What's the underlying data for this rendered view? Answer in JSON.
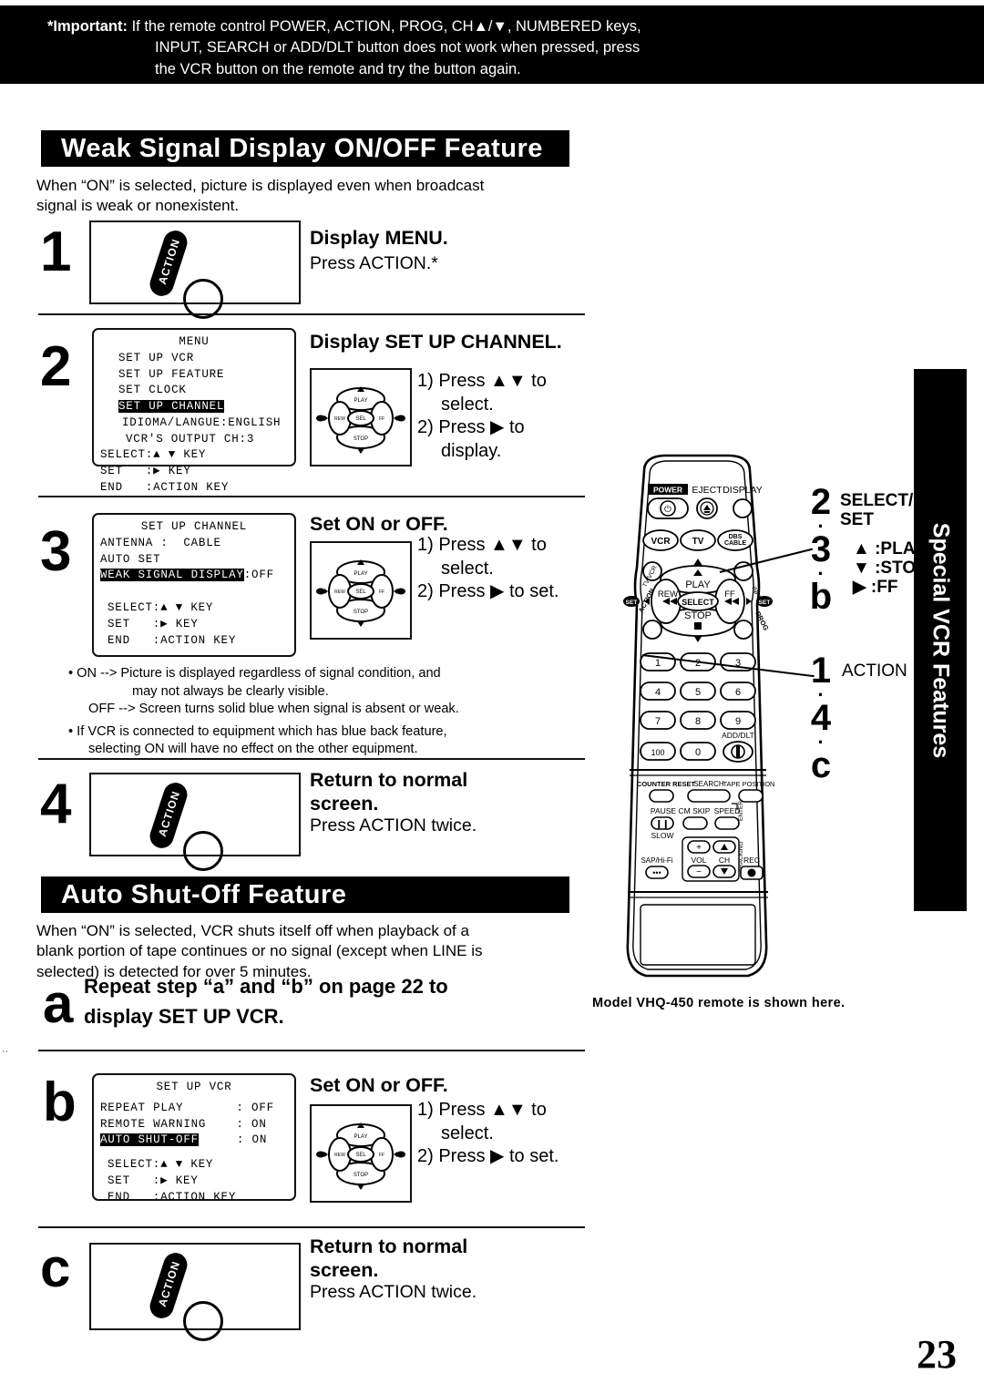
{
  "important": {
    "label": "*Important:",
    "line1": "If the remote control POWER, ACTION, PROG, CH▲/▼, NUMBERED keys,",
    "line2": "INPUT,  SEARCH or ADD/DLT button does not work when pressed, press",
    "line3": "the VCR button on the remote and try the button again."
  },
  "section1": {
    "banner": "Weak Signal Display ON/OFF Feature",
    "intro_line1": "When “ON” is selected, picture is displayed even when broadcast",
    "intro_line2": "signal is weak or nonexistent.",
    "step1": {
      "number": "1",
      "button_label": "ACTION",
      "heading": "Display MENU.",
      "sub": "Press ACTION.*"
    },
    "step2": {
      "number": "2",
      "heading": "Display SET UP CHANNEL.",
      "osd": {
        "title": "MENU",
        "rows": [
          "SET UP VCR",
          "SET UP FEATURE",
          "SET CLOCK"
        ],
        "highlight": "SET UP CHANNEL",
        "rows_after": [
          "IDIOMA/LANGUE:ENGLISH",
          "VCR'S OUTPUT CH:3"
        ],
        "footer": [
          "SELECT:▲ ▼ KEY",
          "SET   :▶ KEY",
          "END   :ACTION KEY"
        ]
      },
      "instr1": "1) Press ▲▼ to",
      "instr1b": "select.",
      "instr2": "2) Press ▶ to",
      "instr2b": "display."
    },
    "step3": {
      "number": "3",
      "heading": "Set ON or OFF.",
      "osd": {
        "title": "SET UP CHANNEL",
        "rows": [
          "ANTENNA :  CABLE",
          "AUTO SET"
        ],
        "highlight": "WEAK SIGNAL DISPLAY",
        "highlight_value": ":OFF",
        "footer": [
          "SELECT:▲ ▼ KEY",
          "SET   :▶ KEY",
          "END   :ACTION KEY"
        ]
      },
      "instr1": "1) Press ▲▼ to",
      "instr1b": "select.",
      "instr2": "2) Press ▶ to set."
    },
    "notes": {
      "n1a": "ON  --> Picture is displayed regardless of signal condition, and",
      "n1b": "may not always be clearly visible.",
      "n1c": "OFF --> Screen turns solid blue when signal is absent or weak.",
      "n2a": "If VCR is connected to equipment which has blue back feature,",
      "n2b": "selecting ON will have no effect on the other equipment."
    },
    "step4": {
      "number": "4",
      "button_label": "ACTION",
      "heading_line1": "Return to normal",
      "heading_line2": "screen.",
      "sub": "Press ACTION twice."
    }
  },
  "section2": {
    "banner": "Auto Shut-Off Feature",
    "intro_line1": "When “ON” is selected, VCR shuts  itself off when playback of a",
    "intro_line2": "blank portion of tape continues or no signal (except when LINE is",
    "intro_line3": "selected) is detected for over 5 minutes.",
    "stepa": {
      "number": "a",
      "heading_line1": "Repeat step “a” and “b” on page 22 to",
      "heading_line2": "display SET UP VCR."
    },
    "stepb": {
      "number": "b",
      "heading": "Set ON or OFF.",
      "osd": {
        "title": "SET UP VCR",
        "rows": [
          "REPEAT PLAY       : OFF",
          "REMOTE WARNING    : ON"
        ],
        "highlight": "AUTO SHUT-OFF",
        "highlight_value": ": ON",
        "footer": [
          "SELECT:▲ ▼ KEY",
          "SET   :▶ KEY",
          "END   :ACTION KEY"
        ]
      },
      "instr1": "1) Press ▲▼ to",
      "instr1b": "select.",
      "instr2": "2) Press ▶ to set."
    },
    "stepc": {
      "number": "c",
      "button_label": "ACTION",
      "heading_line1": "Return to normal",
      "heading_line2": "screen.",
      "sub": "Press ACTION twice."
    }
  },
  "remote": {
    "caption": "Model VHQ-450 remote is shown here.",
    "top_labels": {
      "power": "POWER",
      "eject": "EJECT",
      "display": "DISPLAY"
    },
    "mode_buttons": [
      "VCR",
      "TV",
      "DBS/CABLE"
    ],
    "pad": {
      "play": "PLAY",
      "stop": "STOP",
      "rew": "REW",
      "ff": "FF",
      "select": "SELECT",
      "left_set": "SET",
      "right_set": "SET",
      "action": "ACTION",
      "prog": "PROG",
      "tv_vcr": "TV/VCR",
      "input": "INPUT"
    },
    "keypad": [
      "1",
      "2",
      "3",
      "4",
      "5",
      "6",
      "7",
      "8",
      "9",
      "100",
      "0"
    ],
    "add_dlt": "ADD/DLT",
    "lower_labels": {
      "counter_reset": "COUNTER RESET",
      "search": "SEARCH",
      "tape_position": "TAPE POSITION",
      "pause": "PAUSE",
      "cm_skip": "CM SKIP",
      "speed": "SPEED",
      "slow": "SLOW",
      "enter": "ENTER",
      "sap_hifi": "SAP/Hi-Fi",
      "vol": "VOL",
      "ch": "CH",
      "rec": "REC",
      "tracking": "TRACKING"
    }
  },
  "callouts": {
    "c1": {
      "big": "2",
      "big2": "3",
      "big3": "b",
      "dot": "·",
      "label1": "SELECT/",
      "label2": "SET",
      "key1": "▲ :PLAY",
      "key2": "▼ :STOP",
      "key3": "▶ :FF"
    },
    "c2": {
      "big": "1",
      "big2": "4",
      "big3": "c",
      "dot": "·",
      "label": "ACTION"
    }
  },
  "sidetab": {
    "text": "Special VCR Features"
  },
  "page_number": "23"
}
